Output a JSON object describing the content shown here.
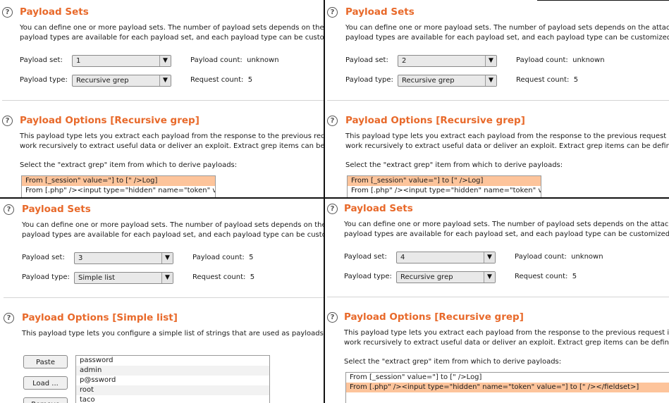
{
  "payload_sets_title": "Payload Sets",
  "payload_sets_desc_1": "You can define one or more payload sets. The number of payload sets depends on the attack t",
  "payload_sets_desc_2": "payload types are available for each payload set, and each payload type can be customized i",
  "payload_set_label": "Payload set:",
  "payload_type_label": "Payload type:",
  "payload_count_label": "Payload count:",
  "request_count_label": "Request count:",
  "recursive_title": "Payload Options [Recursive grep]",
  "recursive_desc_1": "This payload type lets you extract each payload from the response to the previous request in",
  "recursive_desc_2": "work recursively to extract useful data or deliver an exploit. Extract grep items can be define",
  "select_prompt": "Select the \"extract grep\" item from which to derive payloads:",
  "grep_items": [
    "From [_session\" value=\"] to [\" />Log]",
    "From [.php\" /><input type=\"hidden\" name=\"token\" value=\"] to [\" /></fieldset>]"
  ],
  "simple_title": "Payload Options [Simple list]",
  "simple_desc": "This payload type lets you configure a simple list of strings that are used as payloads.",
  "buttons": {
    "paste": "Paste",
    "load": "Load ...",
    "remove": "Remove"
  },
  "simple_list": [
    "password",
    "admin",
    "p@ssword",
    "root",
    "taco"
  ],
  "help_glyph": "?",
  "arrow_glyph": "▼",
  "panels": [
    {
      "set": "1",
      "type": "Recursive grep",
      "payload_count": "unknown",
      "request_count": "5",
      "selected_grep": 0
    },
    {
      "set": "2",
      "type": "Recursive grep",
      "payload_count": "unknown",
      "request_count": "5",
      "selected_grep": 0
    },
    {
      "set": "3",
      "type": "Simple list",
      "payload_count": "5",
      "request_count": "5"
    },
    {
      "set": "4",
      "type": "Recursive grep",
      "payload_count": "unknown",
      "request_count": "5",
      "selected_grep": 1
    }
  ],
  "colors": {
    "title": "#e8692a",
    "selection": "#fdc49b",
    "divider": "#111111"
  }
}
